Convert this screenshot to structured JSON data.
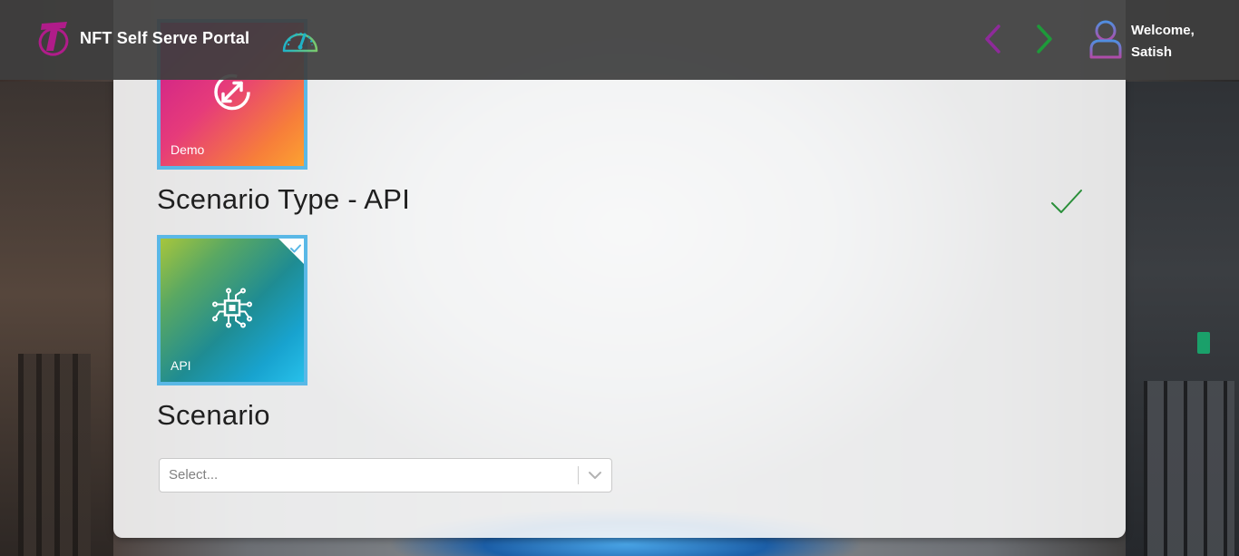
{
  "header": {
    "app_title": "NFT Self Serve Portal",
    "welcome_line1": "Welcome,",
    "welcome_line2": "Satish",
    "icons": {
      "logo": "telstra-logo-icon",
      "dashboard": "speedometer-icon",
      "back": "chevron-left-icon",
      "forward": "chevron-right-icon",
      "user": "user-icon"
    }
  },
  "tiles": {
    "demo": {
      "label": "Demo",
      "icon": "refresh-circle-icon",
      "selected": false
    },
    "api": {
      "label": "API",
      "icon": "circuit-chip-icon",
      "selected": true
    }
  },
  "sections": {
    "scenario_type": "Scenario Type - API",
    "scenario": "Scenario"
  },
  "scenario_select": {
    "placeholder": "Select...",
    "value": ""
  },
  "colors": {
    "brand_magenta": "#c71a8f",
    "tile_border": "#5ab8e6",
    "nav_prev": "#8e2a9a",
    "nav_next": "#1e9a3a",
    "check_green": "#2a8f3a",
    "topbar": "#3e3e3e"
  }
}
